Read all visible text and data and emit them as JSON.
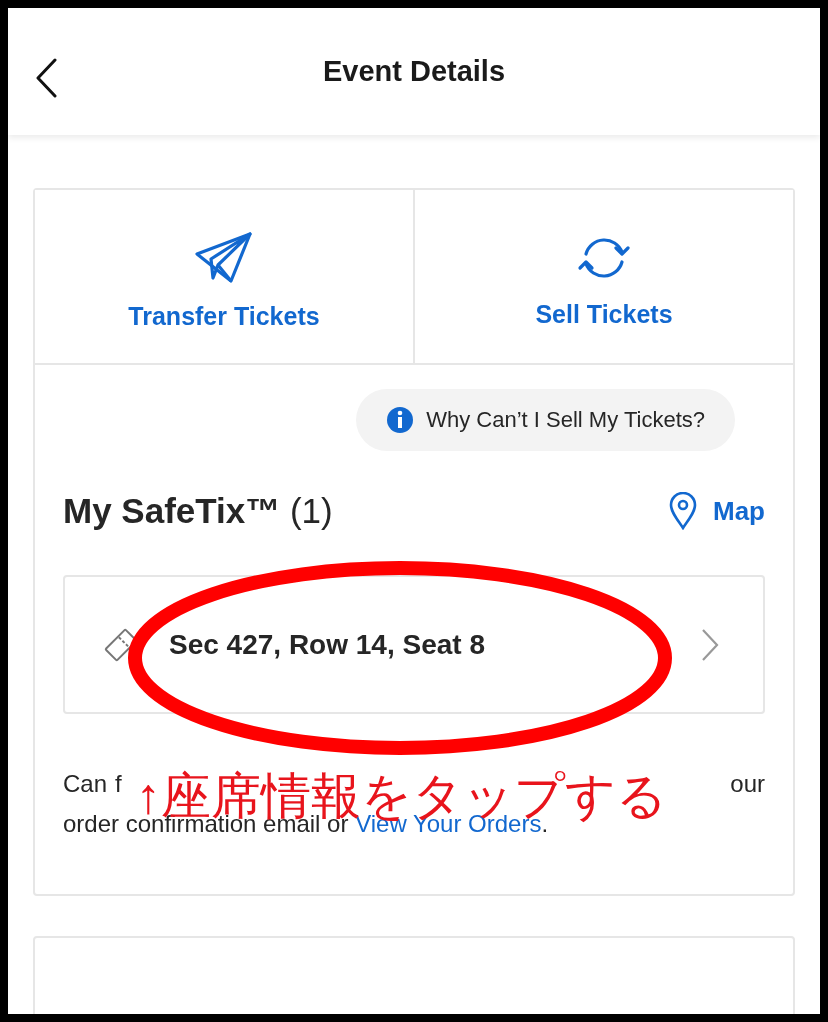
{
  "header": {
    "title": "Event Details"
  },
  "actions": [
    {
      "label": "Transfer Tickets",
      "kind": "transfer"
    },
    {
      "label": "Sell Tickets",
      "kind": "sell"
    }
  ],
  "info_pill": {
    "label": "Why Can’t I Sell My Tickets?"
  },
  "tickets_section": {
    "title": "My SafeTix™",
    "count": "(1)",
    "map_link": "Map",
    "tickets": [
      {
        "seat": "Sec 427, Row 14, Seat 8"
      }
    ]
  },
  "note": {
    "line_1_fragments": [
      "Can",
      "f",
      "our"
    ],
    "line_2": "order confirmation email or",
    "link": "View Your Orders",
    "end": "."
  },
  "annotation": {
    "text": "↑座席情報をタップする"
  }
}
